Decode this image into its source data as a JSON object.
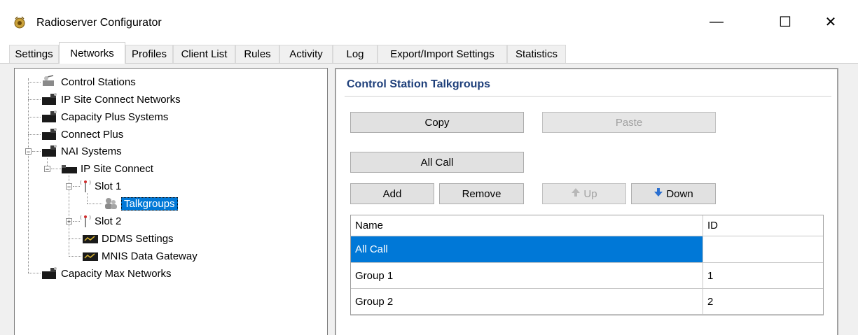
{
  "window": {
    "title": "Radioserver Configurator",
    "minimize": "—",
    "maximize": "☐",
    "close": "✕"
  },
  "tabs": [
    {
      "label": "Settings",
      "active": false
    },
    {
      "label": "Networks",
      "active": true
    },
    {
      "label": "Profiles",
      "active": false
    },
    {
      "label": "Client List",
      "active": false
    },
    {
      "label": "Rules",
      "active": false
    },
    {
      "label": "Activity",
      "active": false
    },
    {
      "label": "Log",
      "active": false
    },
    {
      "label": "Export/Import Settings",
      "active": false
    },
    {
      "label": "Statistics",
      "active": false
    }
  ],
  "tree": {
    "control_stations": "Control Stations",
    "ip_site_connect_networks": "IP Site Connect Networks",
    "capacity_plus_systems": "Capacity Plus Systems",
    "connect_plus": "Connect Plus",
    "nai_systems": "NAI Systems",
    "ip_site_connect": "IP Site Connect",
    "slot1": "Slot 1",
    "talkgroups": "Talkgroups",
    "slot2": "Slot 2",
    "ddms_settings": "DDMS Settings",
    "mnis_data_gateway": "MNIS Data Gateway",
    "capacity_max_networks": "Capacity Max Networks",
    "expander_minus": "−",
    "expander_plus": "+"
  },
  "panel": {
    "title": "Control Station Talkgroups",
    "copy": "Copy",
    "paste": "Paste",
    "all_call": "All Call",
    "add": "Add",
    "remove": "Remove",
    "up": "Up",
    "down": "Down"
  },
  "grid": {
    "columns": [
      "Name",
      "ID"
    ],
    "rows": [
      {
        "name": "All Call",
        "id": "",
        "selected": true
      },
      {
        "name": "Group 1",
        "id": "1",
        "selected": false
      },
      {
        "name": "Group 2",
        "id": "2",
        "selected": false
      }
    ]
  },
  "colors": {
    "selection": "#0078d7",
    "section_title": "#1e3f7a"
  }
}
